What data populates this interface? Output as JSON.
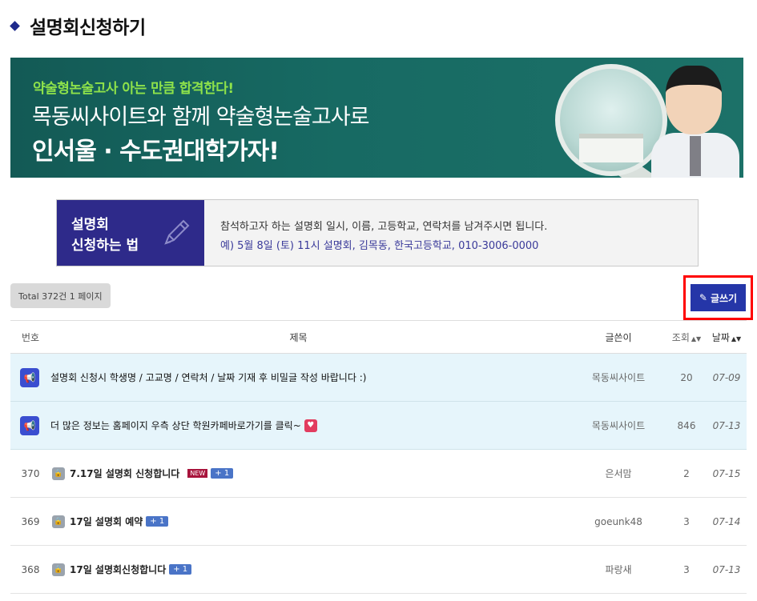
{
  "page": {
    "title": "설명회신청하기"
  },
  "banner": {
    "subtitle": "약술형논술고사 아는 만큼 합격한다!",
    "line1": "목동씨사이트와 함께 약술형논술고사로",
    "line2": "인서울 · 수도권대학가자!"
  },
  "howto": {
    "label_line1": "설명회",
    "label_line2": "신청하는 법",
    "instruction": "참석하고자 하는 설명회 일시, 이름, 고등학교, 연락처를 남겨주시면 됩니다.",
    "example": "예) 5월 8일 (토) 11시 설명회, 김목동, 한국고등학교, 010-3006-0000"
  },
  "board": {
    "total_label": "Total 372건 1 페이지",
    "write_button": "글쓰기",
    "columns": {
      "num": "번호",
      "title": "제목",
      "author": "글쓴이",
      "views": "조회",
      "date": "날짜"
    },
    "notices": [
      {
        "title": "설명회 신청시 학생명 / 고교명 / 연락처 / 날짜 기재 후 비밀글 작성 바랍니다 :)",
        "author": "목동씨사이트",
        "views": "20",
        "date": "07-09"
      },
      {
        "title": "더 많은 정보는 홈페이지 우측 상단 학원카페바로가기를 클릭~",
        "author": "목동씨사이트",
        "views": "846",
        "date": "07-13"
      }
    ],
    "posts": [
      {
        "num": "370",
        "title": "7.17일 설명회 신청합니다",
        "new": "NEW",
        "comments": "+ 1",
        "author": "은서맘",
        "views": "2",
        "date": "07-15"
      },
      {
        "num": "369",
        "title": "17일 설명회 예약",
        "comments": "+ 1",
        "author": "goeunk48",
        "views": "3",
        "date": "07-14"
      },
      {
        "num": "368",
        "title": "17일 설명회신청합니다",
        "comments": "+ 1",
        "author": "파랑새",
        "views": "3",
        "date": "07-13"
      }
    ]
  },
  "icons": {
    "title_marker": "diamond-icon",
    "notice": "megaphone-icon",
    "secret": "lock-icon",
    "heart": "heart-icon",
    "pen": "pencil-icon"
  },
  "colors": {
    "accent": "#2536a8",
    "howto_label_bg": "#2e2a8a",
    "banner_bg": "#176a63",
    "notice_row_bg": "#e6f5fb",
    "highlight_border": "#ff0000",
    "new_badge": "#a8143c",
    "comment_badge": "#4a74c7"
  }
}
